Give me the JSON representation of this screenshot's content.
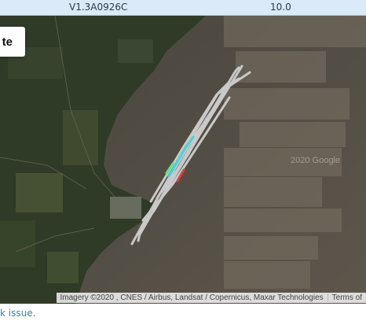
{
  "header": {
    "version": "V1.3A0926C",
    "value": "10.0"
  },
  "map": {
    "label_fragment": "te",
    "watermark": "2020 Google",
    "attribution": "Imagery ©2020 , CNES / Airbus, Landsat / Copernicus, Maxar Technologies",
    "terms": "Terms of"
  },
  "footer": {
    "link_text": "k issue."
  },
  "colors": {
    "header_bg": "#daeaf6",
    "water": "#5b5449",
    "land": "#2f3b26",
    "track": "#c9c9c9",
    "track_highlight_cyan": "#3fd6e0",
    "track_highlight_red": "#e23b3b",
    "link": "#3b7ec1"
  }
}
